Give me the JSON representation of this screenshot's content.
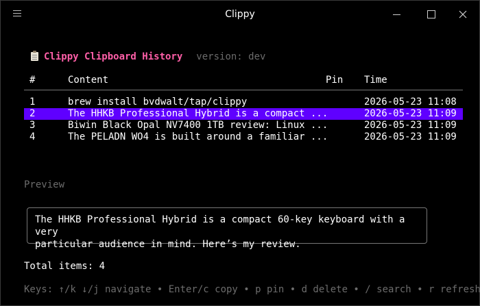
{
  "window": {
    "title": "Clippy"
  },
  "header": {
    "app_name": "Clippy Clipboard History",
    "version": "version: dev"
  },
  "table": {
    "columns": {
      "num": "#",
      "content": "Content",
      "pin": "Pin",
      "time": "Time"
    },
    "rows": [
      {
        "num": "1",
        "content": "brew install bvdwalt/tap/clippy",
        "pin": "",
        "time": "2026-05-23 11:08"
      },
      {
        "num": "2",
        "content": "The HHKB Professional Hybrid is a compact ...",
        "pin": "",
        "time": "2026-05-23 11:09"
      },
      {
        "num": "3",
        "content": "Biwin Black Opal NV7400 1TB review: Linux ...",
        "pin": "",
        "time": "2026-05-23 11:09"
      },
      {
        "num": "4",
        "content": "The PELADN WO4 is built around a familiar ...",
        "pin": "",
        "time": "2026-05-23 11:09"
      }
    ],
    "selected_index": 1
  },
  "preview": {
    "label": "Preview",
    "text": "The HHKB Professional Hybrid is a compact 60-key keyboard with a very\nparticular audience in mind. Here’s my review."
  },
  "footer": {
    "total": "Total items: 4",
    "keys": "Keys: ↑/k ↓/j navigate • Enter/c copy • p pin • d delete • / search • r refresh"
  },
  "colors": {
    "accent_pink": "#ff5fa8",
    "selection": "#5f00ff",
    "muted": "#6c6c6c"
  }
}
